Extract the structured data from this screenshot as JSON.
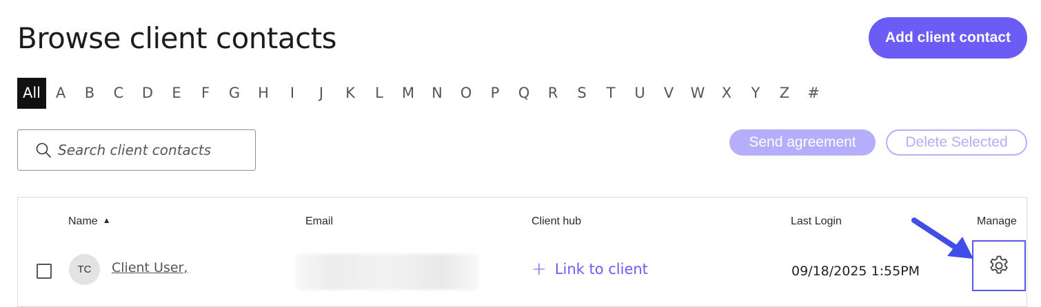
{
  "header": {
    "title": "Browse client contacts",
    "add_button_label": "Add client contact"
  },
  "alpha_filter": {
    "active": "All",
    "items": [
      "All",
      "A",
      "B",
      "C",
      "D",
      "E",
      "F",
      "G",
      "H",
      "I",
      "J",
      "K",
      "L",
      "M",
      "N",
      "O",
      "P",
      "Q",
      "R",
      "S",
      "T",
      "U",
      "V",
      "W",
      "X",
      "Y",
      "Z",
      "#"
    ]
  },
  "search": {
    "placeholder": "Search client contacts",
    "value": ""
  },
  "actions": {
    "send_agreement_label": "Send agreement",
    "delete_selected_label": "Delete Selected"
  },
  "table": {
    "columns": {
      "name": "Name",
      "email": "Email",
      "client_hub": "Client hub",
      "last_login": "Last Login",
      "manage": "Manage"
    },
    "sort_indicator": "▲",
    "rows": [
      {
        "initials": "TC",
        "name": "Client User,",
        "email": "",
        "client_hub_link": "Link to client",
        "last_login": "09/18/2025 1:55PM"
      }
    ]
  },
  "colors": {
    "accent": "#6a5cf5",
    "accent_disabled": "#b5aefb",
    "annotation_arrow": "#3f4ee8"
  },
  "icons": {
    "search": "search-icon",
    "plus": "plus-icon",
    "manage": "gear-icon",
    "sort": "sort-ascending-icon"
  }
}
